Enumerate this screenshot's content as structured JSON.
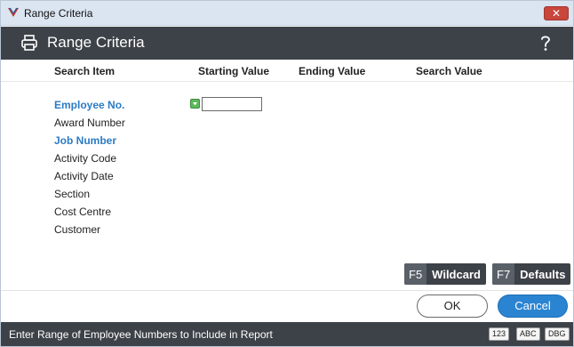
{
  "window": {
    "title": "Range Criteria",
    "close_glyph": "✕"
  },
  "header": {
    "title": "Range Criteria",
    "print_icon": "printer-icon",
    "help_icon": "help-icon"
  },
  "columns": {
    "search_item": "Search Item",
    "starting_value": "Starting Value",
    "ending_value": "Ending Value",
    "search_value": "Search Value"
  },
  "items": [
    {
      "label": "Employee No.",
      "active": true
    },
    {
      "label": "Award Number",
      "active": false
    },
    {
      "label": "Job Number",
      "active": true
    },
    {
      "label": "Activity Code",
      "active": false
    },
    {
      "label": "Activity Date",
      "active": false
    },
    {
      "label": "Section",
      "active": false
    },
    {
      "label": "Cost Centre",
      "active": false
    },
    {
      "label": "Customer",
      "active": false
    }
  ],
  "employee_start": {
    "value": ""
  },
  "fkeys": {
    "wildcard": {
      "key": "F5",
      "label": "Wildcard"
    },
    "defaults": {
      "key": "F7",
      "label": "Defaults"
    }
  },
  "buttons": {
    "ok": "OK",
    "cancel": "Cancel"
  },
  "status": {
    "text": "Enter Range of Employee Numbers to Include in Report",
    "badges": [
      "123",
      "ABC",
      "DBG"
    ]
  },
  "colors": {
    "accent": "#2a84d2",
    "header_bg": "#3d4248",
    "active_item": "#2c7bc4",
    "close_red": "#c9463d"
  }
}
